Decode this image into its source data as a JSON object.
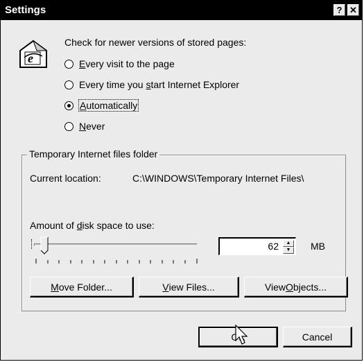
{
  "window": {
    "title": "Settings",
    "help_glyph": "?",
    "close_glyph": "✕"
  },
  "check": {
    "question": "Check for newer versions of stored pages:",
    "options": [
      {
        "pre": "",
        "key": "E",
        "post": "very visit to the page",
        "checked": false
      },
      {
        "pre": "Every time you ",
        "key": "s",
        "post": "tart Internet Explorer",
        "checked": false
      },
      {
        "pre": "",
        "key": "A",
        "post": "utomatically",
        "checked": true
      },
      {
        "pre": "",
        "key": "N",
        "post": "ever",
        "checked": false
      }
    ]
  },
  "folder_group": {
    "legend": "Temporary Internet files folder",
    "location_label": "Current location:",
    "location_value": "C:\\WINDOWS\\Temporary Internet Files\\",
    "disk_label_pre": "Amount of ",
    "disk_label_key": "d",
    "disk_label_post": "isk space to use:",
    "disk_value": "62",
    "disk_unit": "MB",
    "slider_fraction": 0.04
  },
  "buttons": {
    "move_key": "M",
    "move_rest": "ove Folder...",
    "view_files_key": "V",
    "view_files_rest": "iew Files...",
    "view_objects_pre": "View ",
    "view_objects_key": "O",
    "view_objects_rest": "bjects...",
    "ok": "OK",
    "cancel": "Cancel"
  },
  "icons": {
    "app": "ie-page-icon",
    "cursor": "arrow-cursor-icon"
  }
}
